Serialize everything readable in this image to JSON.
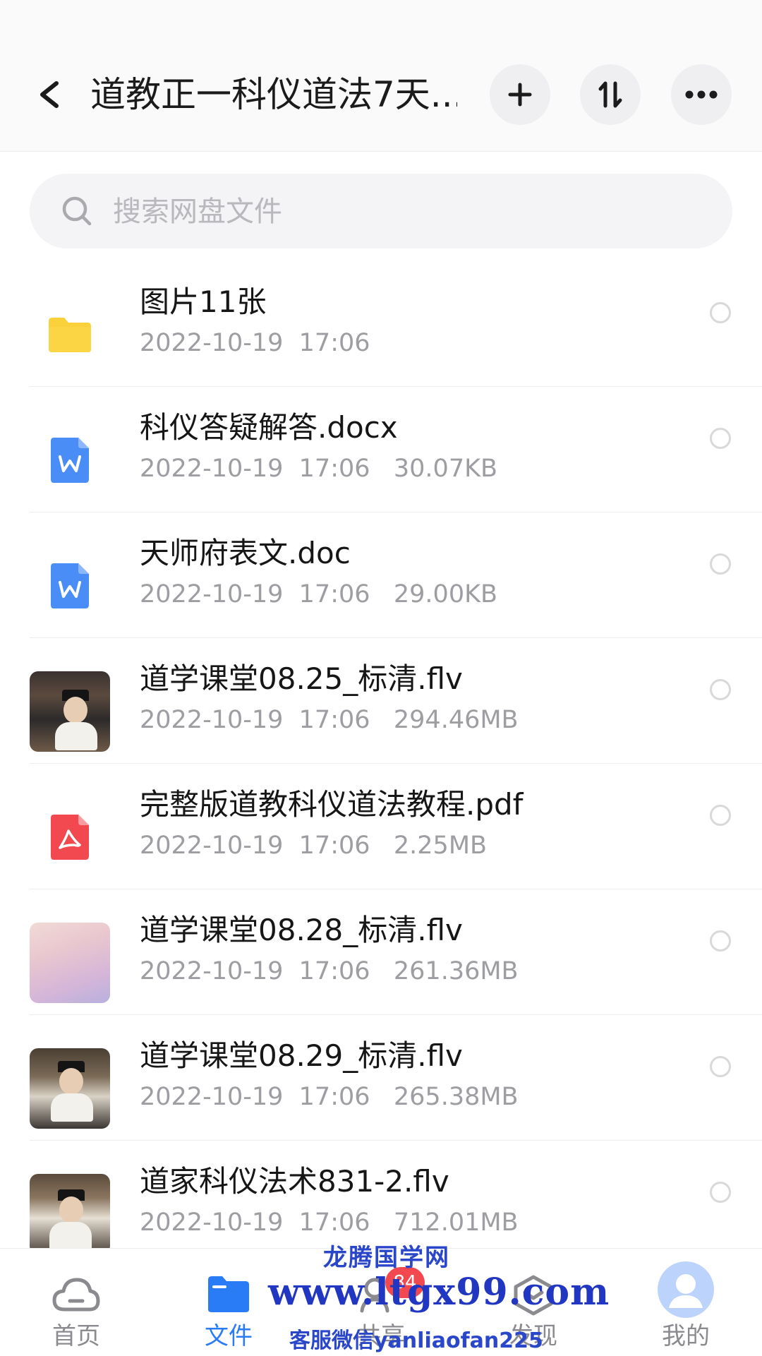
{
  "header": {
    "title": "道教正一科仪道法7天...",
    "back_icon": "chevron-left-icon",
    "actions": [
      {
        "name": "add",
        "icon": "plus-icon"
      },
      {
        "name": "sort",
        "icon": "sort-arrows-icon"
      },
      {
        "name": "more",
        "icon": "more-dots-icon"
      }
    ]
  },
  "search": {
    "placeholder": "搜索网盘文件",
    "icon": "search-icon"
  },
  "files": [
    {
      "name": "图片11张",
      "meta": "2022-10-19  17:06",
      "type": "folder"
    },
    {
      "name": "科仪答疑解答.docx",
      "meta": "2022-10-19  17:06   30.07KB",
      "type": "word"
    },
    {
      "name": "天师府表文.doc",
      "meta": "2022-10-19  17:06   29.00KB",
      "type": "word"
    },
    {
      "name": "道学课堂08.25_标清.flv",
      "meta": "2022-10-19  17:06   294.46MB",
      "type": "video"
    },
    {
      "name": "完整版道教科仪道法教程.pdf",
      "meta": "2022-10-19  17:06   2.25MB",
      "type": "pdf"
    },
    {
      "name": "道学课堂08.28_标清.flv",
      "meta": "2022-10-19  17:06   261.36MB",
      "type": "video"
    },
    {
      "name": "道学课堂08.29_标清.flv",
      "meta": "2022-10-19  17:06   265.38MB",
      "type": "video"
    },
    {
      "name": "道家科仪法术831-2.flv",
      "meta": "2022-10-19  17:06   712.01MB",
      "type": "video"
    }
  ],
  "bottom_nav": {
    "items": [
      {
        "label": "首页",
        "icon": "cloud-icon",
        "active": false
      },
      {
        "label": "文件",
        "icon": "folder-icon",
        "active": true
      },
      {
        "label": "共享",
        "icon": "share-icon",
        "active": false,
        "badge": "84"
      },
      {
        "label": "发现",
        "icon": "discover-icon",
        "active": false
      },
      {
        "label": "我的",
        "icon": "avatar-icon",
        "active": false
      }
    ]
  },
  "watermark": {
    "site_name": "龙腾国学网",
    "url": "www.ltgx99.com",
    "contact": "客服微信yanliaofan225"
  },
  "colors": {
    "accent": "#2a7bf6",
    "folder": "#fbd13b",
    "word": "#4a8df6",
    "pdf": "#f2484f",
    "badge": "#f2484f",
    "watermark": "#2137c2"
  }
}
